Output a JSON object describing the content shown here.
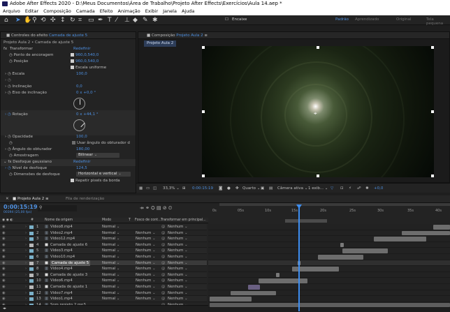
{
  "window": {
    "title": "Adobe After Effects 2020 - D:\\Meus Documentos\\Área de Trabalho\\Projeto After Effects\\Exercícios\\Aula 14.aep *"
  },
  "menu": [
    "Arquivo",
    "Editar",
    "Composição",
    "Camada",
    "Efeito",
    "Animação",
    "Exibir",
    "Janela",
    "Ajuda"
  ],
  "toolbar": {
    "snap_label": "Encaixe",
    "workspaces": [
      "Padrão",
      "Aprendizado",
      "Original",
      "Tela pequena"
    ],
    "active_workspace": "Padrão"
  },
  "effects": {
    "tab_label": "Controles do efeito",
    "tab_target": "Camada de ajuste 5",
    "breadcrumb": "Projeto Aula 2 • Camada de ajuste 5",
    "transform": {
      "label": "Transformar",
      "reset": "Redefinir",
      "anchor_label": "Ponto de ancoragem",
      "anchor_value": "960,0,540,0",
      "position_label": "Posição",
      "position_value": "960,0,540,0",
      "uniform_scale_label": "Escala uniforme",
      "scale_label": "Escala",
      "scale_value": "100,0",
      "skew_label": "Inclinação",
      "skew_value": "0,0",
      "skew_axis_label": "Eixo de inclinação",
      "skew_axis_value": "0 x +0,0 °",
      "rotation_label": "Rotação",
      "rotation_value": "0 x +44,1 °",
      "opacity_label": "Opacidade",
      "opacity_value": "100,0",
      "shutter_comp_label": "Usar ângulo do obturador d",
      "shutter_angle_label": "Ângulo do obturador",
      "shutter_angle_value": "180,00",
      "sampling_label": "Amostragem",
      "sampling_value": "Bilinear"
    },
    "blur": {
      "label": "Desfoque gaussiano",
      "reset": "Redefinir",
      "amount_label": "Nível de desfoque",
      "amount_value": "124,5",
      "dims_label": "Dimensões de desfoque",
      "dims_value": "Horizontal e vertical",
      "repeat_label": "Repetir pixels da borda"
    }
  },
  "composition": {
    "tab_label": "Composição",
    "tab_target": "Projeto Aula 2",
    "subtab": "Projeto Aula 2"
  },
  "viewer_bar": {
    "zoom": "33,3%",
    "timecode": "0:00:15:19",
    "quality": "Quarto",
    "camera": "Câmera ativa",
    "views": "1 exib...",
    "exposure": "+0,0"
  },
  "timeline": {
    "comp_tab": "Projeto Aula 2",
    "render_queue": "Fila de renderização",
    "current_time": "0:00:15:19",
    "frame_sub": "00394 (25,00 fps)",
    "search_placeholder": "",
    "columns": {
      "num": "#",
      "source": "Nome da origem",
      "mode": "Modo",
      "t": "T",
      "trkmat": "Fosco de cont...",
      "parent": "Transformar em principal..."
    },
    "ruler": [
      "0s",
      "05s",
      "10s",
      "15s",
      "20s",
      "25s",
      "30s",
      "35s",
      "40s"
    ],
    "layers": [
      {
        "num": "1",
        "name": "Video8.mp4",
        "mode": "Normal",
        "trk": "",
        "parent": "Nenhum",
        "color": "#7ab0c8",
        "type": "video",
        "bar_start": 620,
        "bar_end": 644,
        "bar_color": "#6d6d6d"
      },
      {
        "num": "2",
        "name": "Video2.mp4",
        "mode": "Normal",
        "trk": "Nenhum",
        "parent": "Nenhum",
        "color": "#7ab0c8",
        "type": "video",
        "bar_start": 575,
        "bar_end": 644,
        "bar_color": "#6d6d6d"
      },
      {
        "num": "3",
        "name": "Video12.mp4",
        "mode": "Normal",
        "trk": "Nenhum",
        "parent": "Nenhum",
        "color": "#7ab0c8",
        "type": "video",
        "bar_start": 535,
        "bar_end": 610,
        "bar_color": "#6d6d6d"
      },
      {
        "num": "4",
        "name": "Camada de ajuste 6",
        "mode": "Normal",
        "trk": "Nenhum",
        "parent": "Nenhum",
        "color": "#b8b8b8",
        "type": "adjust",
        "bar_start": 487,
        "bar_end": 492,
        "bar_color": "#7a7a7a"
      },
      {
        "num": "5",
        "name": "Video3.mp4",
        "mode": "Normal",
        "trk": "Nenhum",
        "parent": "Nenhum",
        "color": "#7ab0c8",
        "type": "video",
        "bar_start": 490,
        "bar_end": 555,
        "bar_color": "#6d6d6d"
      },
      {
        "num": "6",
        "name": "Video10.mp4",
        "mode": "Normal",
        "trk": "Nenhum",
        "parent": "Nenhum",
        "color": "#7ab0c8",
        "type": "video",
        "bar_start": 455,
        "bar_end": 520,
        "bar_color": "#6d6d6d"
      },
      {
        "num": "7",
        "name": "Camada de ajuste 5",
        "mode": "Normal",
        "trk": "Nenhum",
        "parent": "Nenhum",
        "color": "#b8b8b8",
        "type": "adjust",
        "bar_start": 426,
        "bar_end": 430,
        "bar_color": "#8a8a8a",
        "selected": true
      },
      {
        "num": "8",
        "name": "Video4.mp4",
        "mode": "Normal",
        "trk": "Nenhum",
        "parent": "Nenhum",
        "color": "#7ab0c8",
        "type": "video",
        "bar_start": 418,
        "bar_end": 485,
        "bar_color": "#6d6d6d"
      },
      {
        "num": "9",
        "name": "Camada de ajuste 3",
        "mode": "Normal",
        "trk": "Nenhum",
        "parent": "Nenhum",
        "color": "#b8b8b8",
        "type": "adjust",
        "bar_start": 395,
        "bar_end": 400,
        "bar_color": "#7a7a7a"
      },
      {
        "num": "10",
        "name": "Video6.mp4",
        "mode": "Normal",
        "trk": "Nenhum",
        "parent": "Nenhum",
        "color": "#7ab0c8",
        "type": "video",
        "bar_start": 370,
        "bar_end": 440,
        "bar_color": "#6d6d6d"
      },
      {
        "num": "11",
        "name": "Camada de ajuste 1",
        "mode": "Normal",
        "trk": "Nenhum",
        "parent": "Nenhum",
        "color": "#b8b8b8",
        "type": "adjust",
        "bar_start": 355,
        "bar_end": 372,
        "bar_color": "#6a6082"
      },
      {
        "num": "12",
        "name": "Video7.mp4",
        "mode": "Normal",
        "trk": "Nenhum",
        "parent": "Nenhum",
        "color": "#7ab0c8",
        "type": "video",
        "bar_start": 330,
        "bar_end": 395,
        "bar_color": "#6d6d6d"
      },
      {
        "num": "13",
        "name": "Video1.mp4",
        "mode": "Normal",
        "trk": "Nenhum",
        "parent": "Nenhum",
        "color": "#7ab0c8",
        "type": "video",
        "bar_start": 300,
        "bar_end": 360,
        "bar_color": "#6d6d6d"
      },
      {
        "num": "14",
        "name": "Som projeto 2.mp3",
        "mode": "",
        "trk": "",
        "parent": "Nenhum",
        "color": "#7ab0c8",
        "type": "audio",
        "bar_start": 300,
        "bar_end": 644,
        "bar_color": "#5e5e5e"
      }
    ]
  }
}
